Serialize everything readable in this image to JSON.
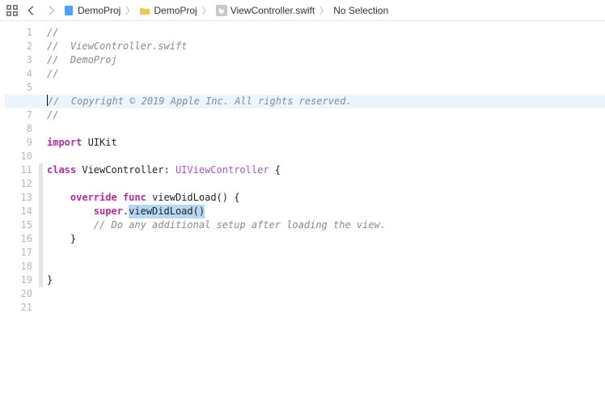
{
  "breadcrumb": {
    "items": [
      {
        "icon": "doc-blue",
        "label": "DemoProj"
      },
      {
        "icon": "folder-yel",
        "label": "DemoProj"
      },
      {
        "icon": "swift-ic",
        "label": "ViewController.swift"
      },
      {
        "icon": "",
        "label": "No Selection"
      }
    ]
  },
  "gutter": {
    "start": 1,
    "end": 21,
    "current": 6
  },
  "code": {
    "l1": "//",
    "l2a": "//  ",
    "l2b": "ViewController.swift",
    "l3a": "//  ",
    "l3b": "DemoProj",
    "l4": "//",
    "l5": "",
    "l6": "//  Copyright © 2019 Apple Inc. All rights reserved.",
    "l7": "//",
    "l8": "",
    "l9a": "import",
    "l9b": " UIKit",
    "l10": "",
    "l11a": "class",
    "l11b": " ViewController: ",
    "l11c": "UIViewController",
    "l11d": " {",
    "l12": "",
    "l13a": "    ",
    "l13b": "override",
    "l13c": " ",
    "l13d": "func",
    "l13e": " viewDidLoad() {",
    "l14a": "        ",
    "l14b": "super",
    "l14c": ".",
    "l14d": "viewDidLoad()",
    "l15a": "        ",
    "l15b": "// Do any additional setup after loading the view.",
    "l16": "    }",
    "l17": "",
    "l18": "",
    "l19": "}",
    "l20": "",
    "l21": ""
  }
}
